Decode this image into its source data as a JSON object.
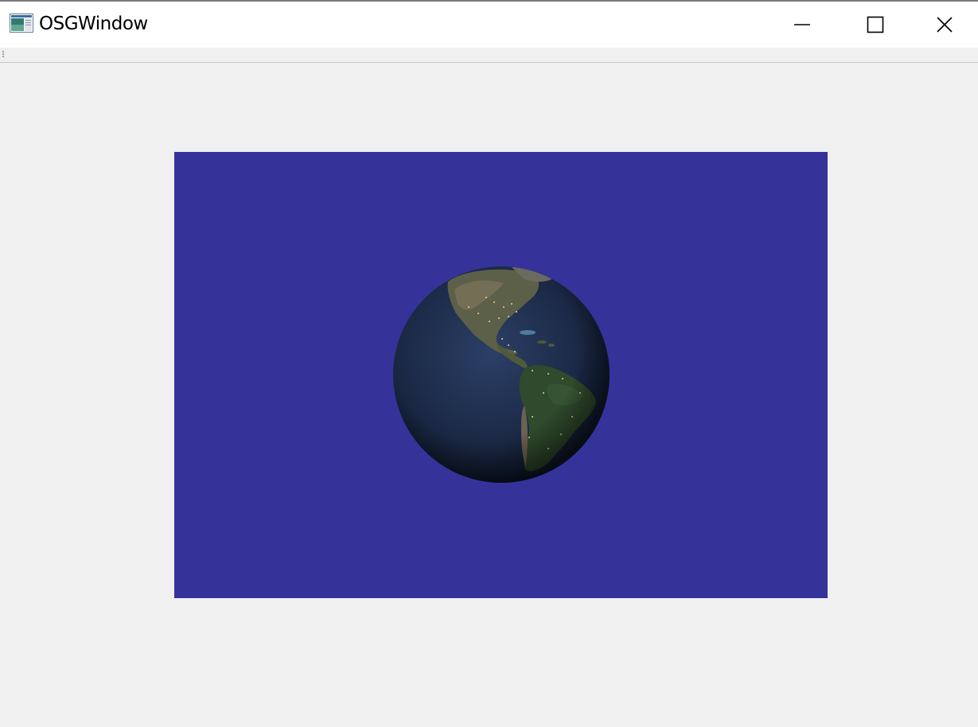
{
  "window": {
    "title": "OSGWindow",
    "controls": {
      "minimize": "minimize-icon",
      "maximize": "maximize-icon",
      "close": "close-icon"
    }
  },
  "viewport": {
    "background_color": "#35339a",
    "content": "earth-globe"
  }
}
